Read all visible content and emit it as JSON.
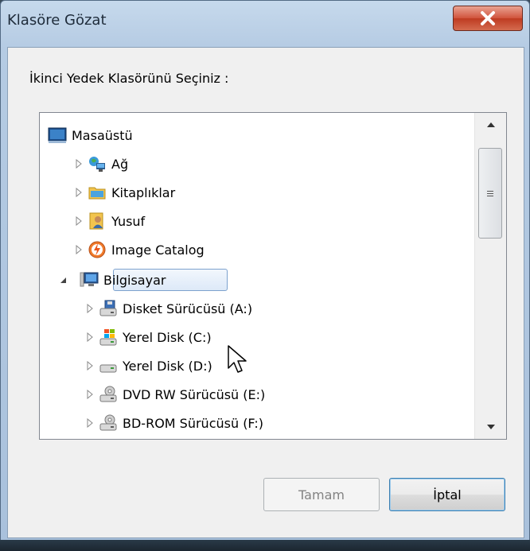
{
  "window": {
    "title": "Klasöre Gözat",
    "close_glyph": "X",
    "instruction": "İkinci Yedek Klasörünü Seçiniz :"
  },
  "tree": {
    "items": [
      {
        "label": "Masaüstü",
        "icon": "desktop-icon",
        "expand": "none",
        "level": 0
      },
      {
        "label": "Ağ",
        "icon": "network-icon",
        "expand": "collapsed",
        "level": 1
      },
      {
        "label": "Kitaplıklar",
        "icon": "libraries-icon",
        "expand": "collapsed",
        "level": 1
      },
      {
        "label": "Yusuf",
        "icon": "user-folder-icon",
        "expand": "collapsed",
        "level": 1
      },
      {
        "label": "Image Catalog",
        "icon": "image-catalog-icon",
        "expand": "collapsed",
        "level": 1
      },
      {
        "label": "Bilgisayar",
        "icon": "computer-icon",
        "expand": "expanded",
        "level": 1,
        "selected": true
      },
      {
        "label": "Disket Sürücüsü (A:)",
        "icon": "floppy-drive-icon",
        "expand": "collapsed",
        "level": 2
      },
      {
        "label": "Yerel Disk (C:)",
        "icon": "windows-drive-icon",
        "expand": "collapsed",
        "level": 2
      },
      {
        "label": "Yerel Disk (D:)",
        "icon": "hard-drive-icon",
        "expand": "collapsed",
        "level": 2
      },
      {
        "label": "DVD RW Sürücüsü (E:)",
        "icon": "dvd-drive-icon",
        "expand": "collapsed",
        "level": 2
      },
      {
        "label": "BD-ROM Sürücüsü (F:)",
        "icon": "bd-drive-icon",
        "expand": "collapsed",
        "level": 2
      }
    ]
  },
  "buttons": {
    "ok_label": "Tamam",
    "ok_enabled": false,
    "cancel_label": "İptal"
  },
  "colors": {
    "close_red": "#c7462d",
    "selection_border": "#7da2ce",
    "focus_border": "#3c7fb1"
  }
}
